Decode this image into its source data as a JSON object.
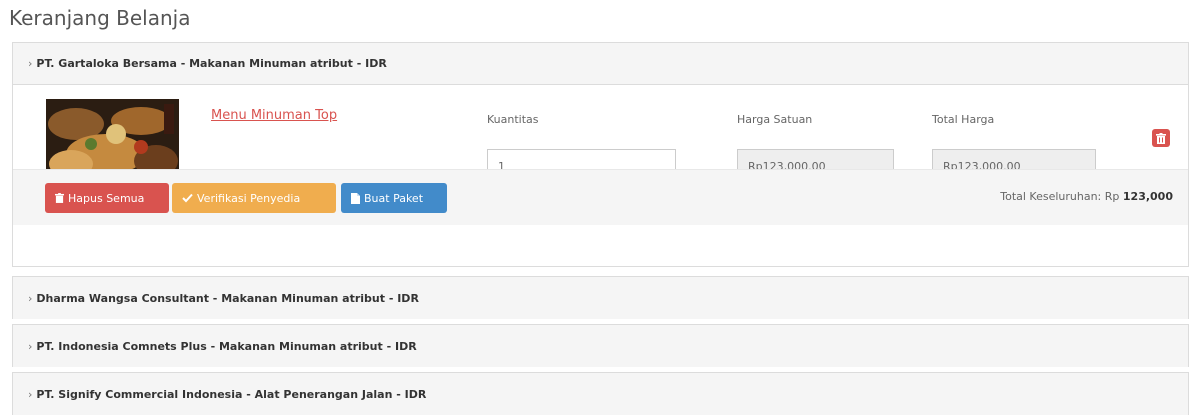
{
  "page": {
    "title": "Keranjang Belanja"
  },
  "colors": {
    "danger": "#d9534f",
    "warning": "#f0ad4e",
    "primary": "#428bca",
    "panel_bg": "#f5f5f5"
  },
  "cart_groups": [
    {
      "header": "PT. Gartaloka Bersama - Makanan Minuman atribut - IDR",
      "expanded": true,
      "item": {
        "name": "Menu Minuman Top",
        "quantity_label": "Kuantitas",
        "quantity_value": "1",
        "unit_price_label": "Harga Satuan",
        "unit_price_value": "Rp123,000.00",
        "total_price_label": "Total Harga",
        "total_price_value": "Rp123,000.00",
        "delete_icon": "trash-icon"
      },
      "actions": {
        "delete_all": "Hapus Semua",
        "verify_vendor": "Verifikasi Penyedia",
        "create_package": "Buat Paket"
      },
      "grand_total_label": "Total Keseluruhan: Rp ",
      "grand_total_value": "123,000"
    },
    {
      "header": "Dharma Wangsa Consultant - Makanan Minuman atribut - IDR",
      "expanded": false
    },
    {
      "header": "PT. Indonesia Comnets Plus - Makanan Minuman atribut - IDR",
      "expanded": false
    },
    {
      "header": "PT. Signify Commercial Indonesia - Alat Penerangan Jalan - IDR",
      "expanded": false
    }
  ]
}
